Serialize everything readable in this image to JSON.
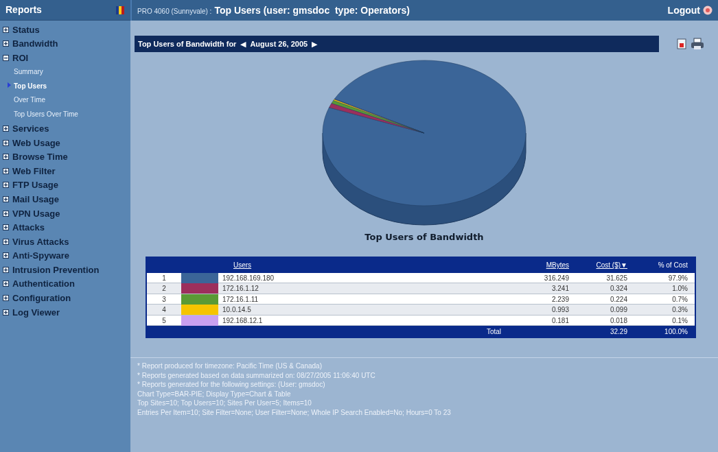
{
  "sidebar": {
    "title": "Reports",
    "items": [
      {
        "label": "Status",
        "expanded": false
      },
      {
        "label": "Bandwidth",
        "expanded": false
      },
      {
        "label": "ROI",
        "expanded": true,
        "children": [
          {
            "label": "Summary",
            "selected": false
          },
          {
            "label": "Top Users",
            "selected": true
          },
          {
            "label": "Over Time",
            "selected": false
          },
          {
            "label": "Top Users Over Time",
            "selected": false
          }
        ]
      },
      {
        "label": "Services",
        "expanded": false
      },
      {
        "label": "Web Usage",
        "expanded": false
      },
      {
        "label": "Browse Time",
        "expanded": false
      },
      {
        "label": "Web Filter",
        "expanded": false
      },
      {
        "label": "FTP Usage",
        "expanded": false
      },
      {
        "label": "Mail Usage",
        "expanded": false
      },
      {
        "label": "VPN Usage",
        "expanded": false
      },
      {
        "label": "Attacks",
        "expanded": false
      },
      {
        "label": "Virus Attacks",
        "expanded": false
      },
      {
        "label": "Anti-Spyware",
        "expanded": false
      },
      {
        "label": "Intrusion Prevention",
        "expanded": false
      },
      {
        "label": "Authentication",
        "expanded": false
      },
      {
        "label": "Configuration",
        "expanded": false
      },
      {
        "label": "Log Viewer",
        "expanded": false
      }
    ]
  },
  "header": {
    "device": "PRO 4060 (Sunnyvale) :",
    "title": "Top Users (user: gmsdoc  type: Operators)",
    "logout": "Logout"
  },
  "report_bar": {
    "label": "Top Users of Bandwidth for",
    "prev": "◀",
    "date": "August 26, 2005",
    "next": "▶"
  },
  "chart": {
    "title": "Top Users of Bandwidth"
  },
  "table": {
    "columns": [
      "Users",
      "MBytes",
      "Cost ($)▼",
      "% of Cost"
    ],
    "rows": [
      {
        "rank": "1",
        "color": "#3b6598",
        "user": "192.168.169.180",
        "mbytes": "316.249",
        "cost": "31.625",
        "percent": "97.9%"
      },
      {
        "rank": "2",
        "color": "#9c2f5c",
        "user": "172.16.1.12",
        "mbytes": "3.241",
        "cost": "0.324",
        "percent": "1.0%"
      },
      {
        "rank": "3",
        "color": "#5a9a35",
        "user": "172.16.1.11",
        "mbytes": "2.239",
        "cost": "0.224",
        "percent": "0.7%"
      },
      {
        "rank": "4",
        "color": "#f5c400",
        "user": "10.0.14.5",
        "mbytes": "0.993",
        "cost": "0.099",
        "percent": "0.3%"
      },
      {
        "rank": "5",
        "color": "#c9a0f0",
        "user": "192.168.12.1",
        "mbytes": "0.181",
        "cost": "0.018",
        "percent": "0.1%"
      }
    ],
    "total": {
      "label": "Total",
      "cost": "32.29",
      "percent": "100.0%"
    }
  },
  "notes": [
    "* Report produced for timezone: Pacific Time (US & Canada)",
    "* Reports generated based on data summarized on: 08/27/2005 11:06:40 UTC",
    "* Reports generated for the following settings: (User: gmsdoc)",
    "Chart Type=BAR-PIE; Display Type=Chart & Table",
    "Top Sites=10; Top Users=10; Sites Per User=5; Items=10",
    "Entries Per Item=10; Site Filter=None; User Filter=None; Whole IP Search Enabled=No; Hours=0 To 23"
  ]
}
